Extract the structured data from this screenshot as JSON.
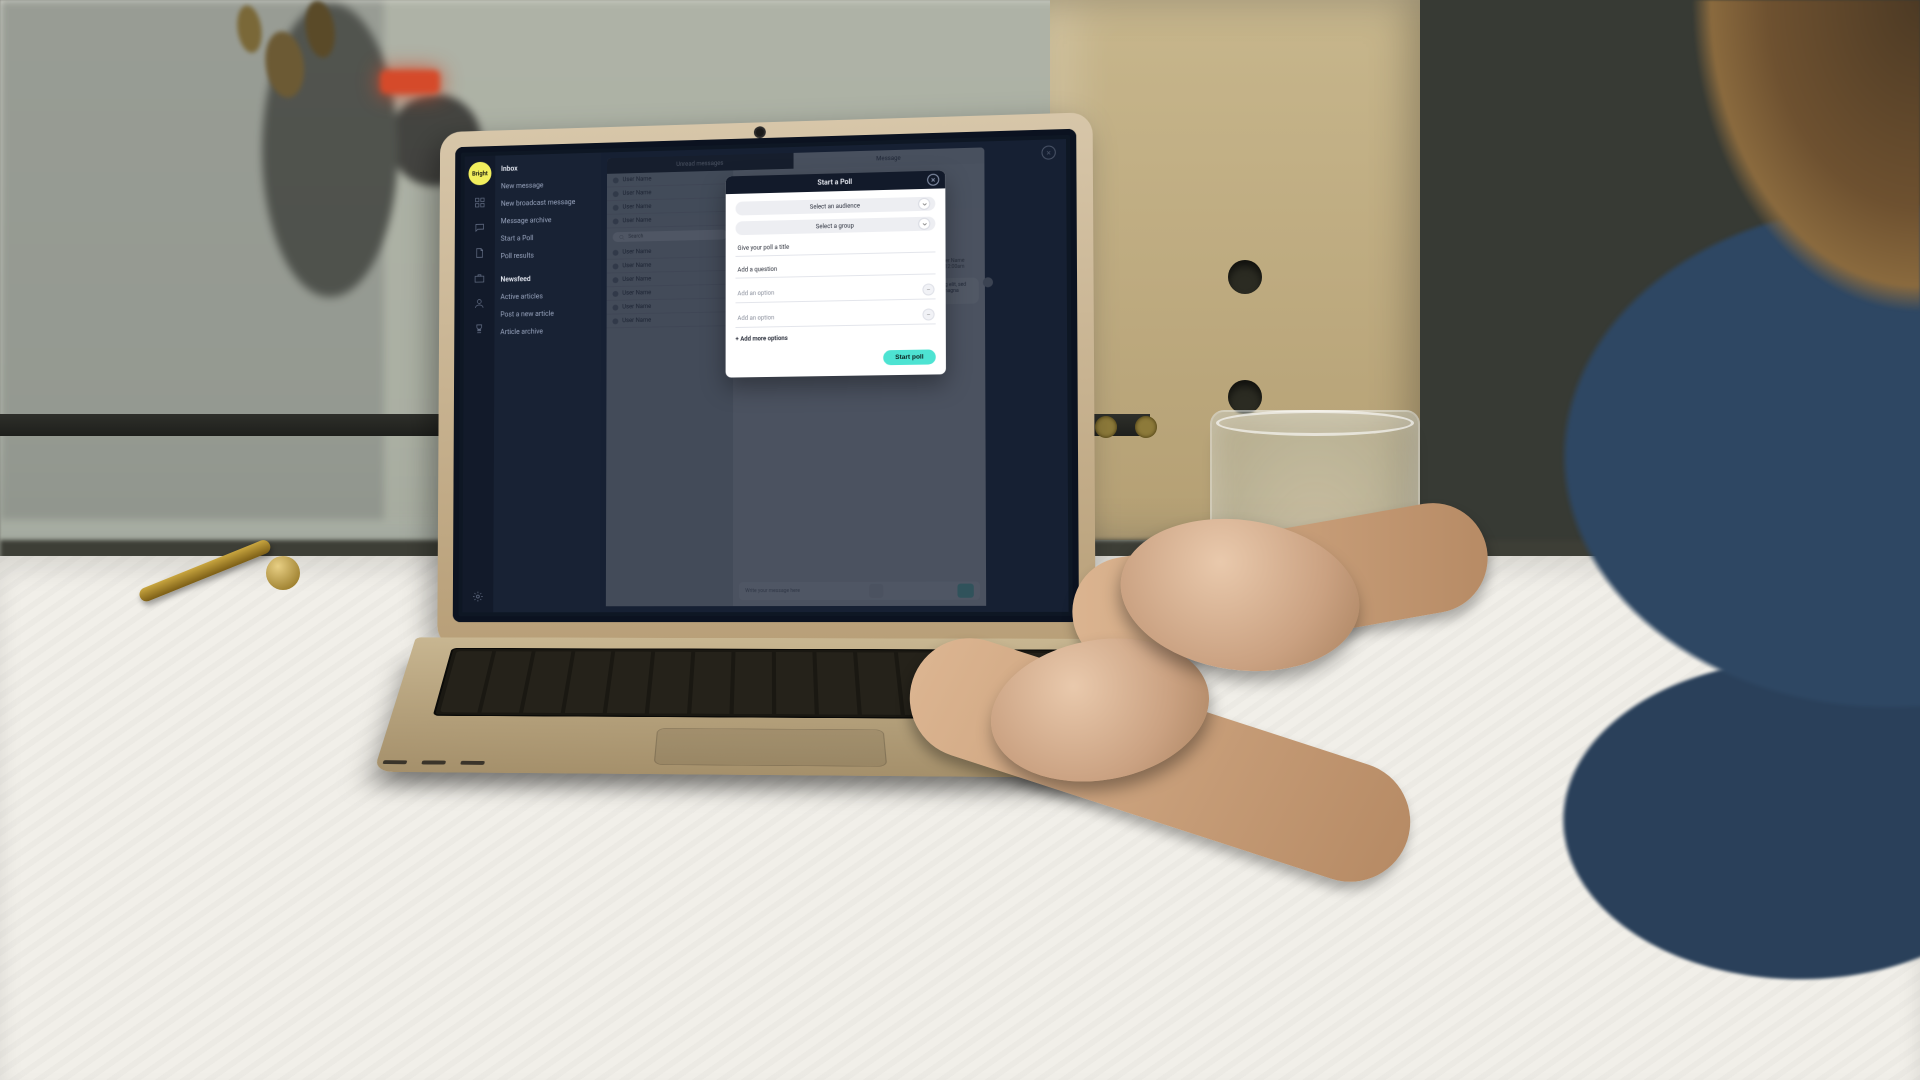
{
  "scene": {
    "description": "Photograph of a person in a denim jacket typing on an open gold/champagne laptop that sits on a white window sill. A glass of water is to the right of the laptop. Outside the window is a blurred street with a stone column. A dried plant is in the upper-left corner.",
    "laptop_color": "#c8b691",
    "has_glass_of_water": true
  },
  "app": {
    "brand": "Bright",
    "top_close_label": "×",
    "rail_icons": [
      "dashboard",
      "messages",
      "document",
      "briefcase",
      "user",
      "trophy",
      "settings"
    ],
    "nav_sections": [
      {
        "title": "Inbox",
        "items": [
          "New message",
          "New broadcast message",
          "Message archive",
          "Start a Poll",
          "Poll results"
        ]
      },
      {
        "title": "Newsfeed",
        "items": [
          "Active articles",
          "Post a new article",
          "Article archive"
        ]
      }
    ],
    "tabs": {
      "left": "Unread messages",
      "right": "Message"
    },
    "search_placeholder": "Search",
    "user_row_label": "User Name",
    "thread": {
      "incoming_meta_name": "User Name",
      "incoming_meta_time": "01 Feb 2022, 12:00am",
      "incoming_body": "Lorem ipsum dolor sit amet, consectetur adipiscing elit, sed do labore et dolore magna aliqua.",
      "outgoing_meta_name": "User Name",
      "outgoing_meta_time": "01 Feb 2022, 12:00am",
      "outgoing_body": "Lorem ipsum dolor sit amet, consectetur adipiscing elit, sed do eiusmod tempor incididunt ut labore et dolore magna aliqua."
    },
    "composer_placeholder": "Write your message here"
  },
  "modal": {
    "title": "Start a Poll",
    "select_audience": "Select an audience",
    "select_group": "Select a group",
    "poll_title_placeholder": "Give your poll a title",
    "question_placeholder": "Add a question",
    "option_placeholder_1": "Add an option",
    "option_placeholder_2": "Add an option",
    "add_more": "+ Add more options",
    "submit": "Start poll",
    "close_label": "×"
  },
  "colors": {
    "accent_yellow": "#f2ef5d",
    "accent_teal": "#4de3d2",
    "app_dark": "#121a2a",
    "app_panel": "#1e2840"
  }
}
